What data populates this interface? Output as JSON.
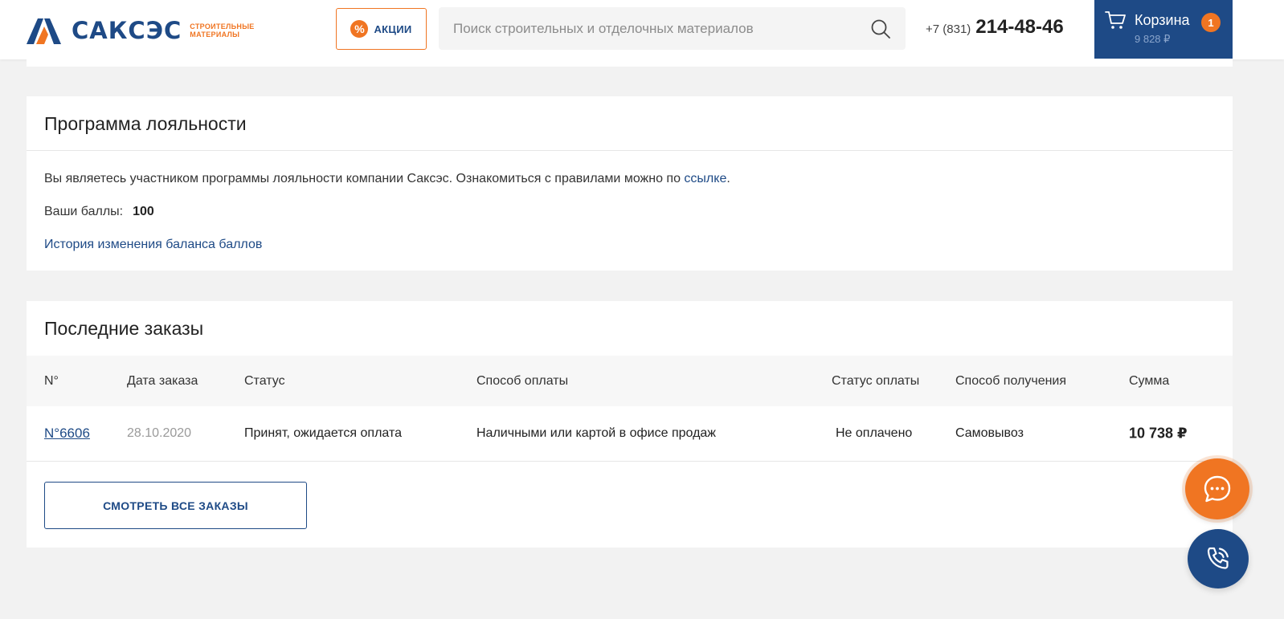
{
  "header": {
    "logo_text": "САКСЭС",
    "logo_sub_line1": "СТРОИТЕЛЬНЫЕ",
    "logo_sub_line2": "МАТЕРИАЛЫ",
    "promo_label": "АКЦИИ",
    "promo_icon": "%",
    "search_placeholder": "Поиск строительных и отделочных материалов",
    "phone_code": "+7 (831)",
    "phone_number": "214-48-46",
    "cart_title": "Корзина",
    "cart_count": "1",
    "cart_sum": "9 828 ₽"
  },
  "loyalty": {
    "title": "Программа лояльности",
    "text": "Вы являетесь участником программы лояльности компании Саксэс. Ознакомиться с правилами можно по ",
    "link": "ссылке",
    "text_end": ".",
    "points_label": "Ваши баллы:",
    "points_value": "100",
    "history_link": "История изменения баланса баллов"
  },
  "orders": {
    "title": "Последние заказы",
    "columns": {
      "num": "N°",
      "date": "Дата заказа",
      "status": "Статус",
      "payment": "Способ оплаты",
      "payment_status": "Статус оплаты",
      "delivery": "Способ получения",
      "sum": "Сумма"
    },
    "rows": [
      {
        "num": "N°6606",
        "date": "28.10.2020",
        "status": "Принят, ожидается оплата",
        "payment": "Наличными или картой в офисе продаж",
        "payment_status": "Не оплачено",
        "delivery": "Самовывоз",
        "sum": "10 738 ₽"
      }
    ],
    "all_button": "СМОТРЕТЬ ВСЕ ЗАКАЗЫ"
  },
  "colors": {
    "brand_blue": "#1e4a86",
    "brand_orange": "#f07522",
    "background": "#f2f2f2"
  },
  "icons": {
    "search": "search-icon",
    "cart": "cart-icon",
    "chat": "chat-icon",
    "call": "phone-call-icon"
  }
}
